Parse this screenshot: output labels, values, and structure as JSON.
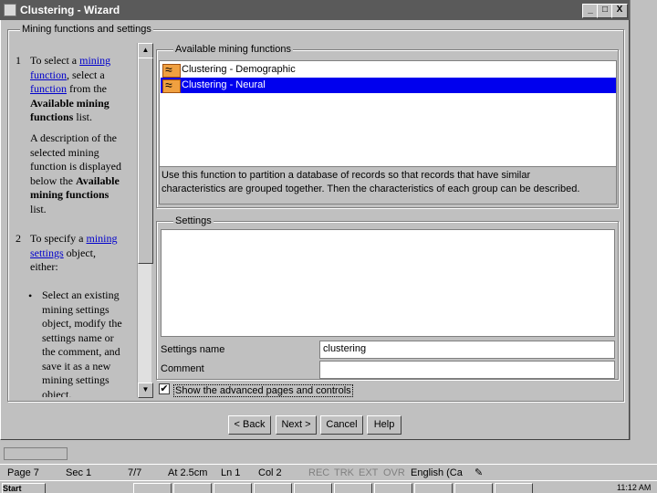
{
  "window": {
    "title": "Clustering - Wizard",
    "min_label": "_",
    "max_label": "□",
    "close_label": "X"
  },
  "left_group": {
    "title": "Mining functions and settings"
  },
  "help": {
    "step1_num": "1",
    "step1_l1a": "To select a ",
    "step1_l1_link": "mining",
    "step1_l2_link": "function",
    "step1_l2b": ", select a",
    "step1_l3_link": "function",
    "step1_l3b": " from the",
    "step1_l4": "Available mining",
    "step1_l5a": "functions",
    "step1_l5b": " list.",
    "desc_l1": "A description of the",
    "desc_l2": "selected mining",
    "desc_l3": "function is displayed",
    "desc_l4a": "below the ",
    "desc_l4b": "Available",
    "desc_l5": "mining functions",
    "desc_l6": "list.",
    "step2_num": "2",
    "step2_l1a": "To specify a ",
    "step2_l1_link": "mining",
    "step2_l2_link": "settings",
    "step2_l2b": " object,",
    "step2_l3": "either:",
    "bullet": "•",
    "b_l1": "Select an existing",
    "b_l2": "mining settings",
    "b_l3": "object, modify the",
    "b_l4": "settings name or",
    "b_l5": "the comment, and",
    "b_l6": "save it as a new",
    "b_l7": "mining settings",
    "b_l8": "object."
  },
  "available": {
    "title": "Available mining functions",
    "items": [
      {
        "label": "Clustering - Demographic",
        "selected": false
      },
      {
        "label": "Clustering - Neural",
        "selected": true
      }
    ],
    "description_l1": "Use this function to partition a database of records so that records that have similar",
    "description_l2": "characteristics are grouped together. Then the characteristics of each group can be described."
  },
  "settings": {
    "title": "Settings",
    "name_label": "Settings name",
    "name_value": "clustering",
    "comment_label": "Comment",
    "comment_value": ""
  },
  "advanced": {
    "checked": true,
    "check_mark": "✔",
    "label": "Show the advanced pages and controls"
  },
  "buttons": {
    "back": "< Back",
    "next": "Next >",
    "cancel": "Cancel",
    "help": "Help"
  },
  "statusbar": {
    "page": "Page 7",
    "sec": "Sec 1",
    "pages": "7/7",
    "at": "At 2.5cm",
    "ln": "Ln 1",
    "col": "Col 2",
    "rec": "REC",
    "trk": "TRK",
    "ext": "EXT",
    "ovr": "OVR",
    "lang": "English (Ca"
  },
  "taskbar": {
    "start": "Start",
    "clock": "11:12 AM"
  },
  "colors": {
    "selection": "#0000ee",
    "link": "#0000cc",
    "titlebar": "#5a5a5a"
  }
}
